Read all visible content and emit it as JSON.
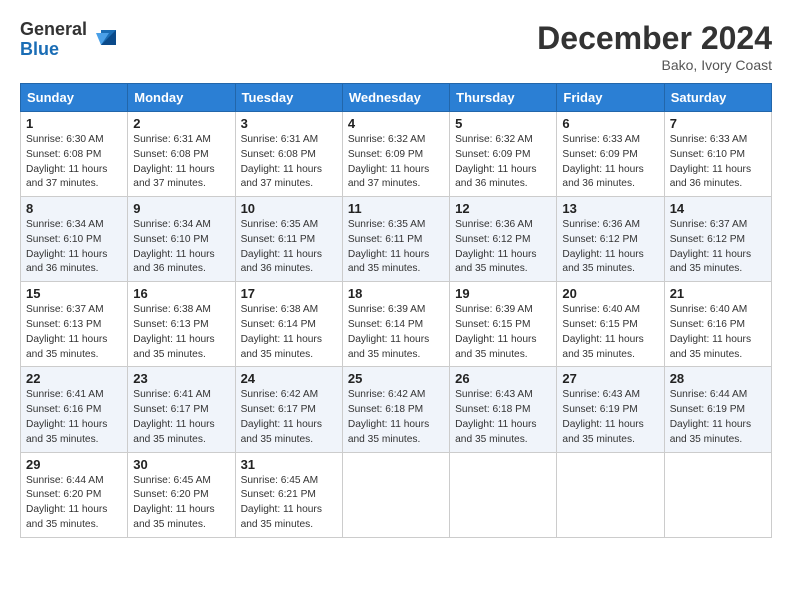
{
  "logo": {
    "general": "General",
    "blue": "Blue"
  },
  "title": "December 2024",
  "location": "Bako, Ivory Coast",
  "days_of_week": [
    "Sunday",
    "Monday",
    "Tuesday",
    "Wednesday",
    "Thursday",
    "Friday",
    "Saturday"
  ],
  "weeks": [
    [
      {
        "day": "1",
        "sunrise": "6:30 AM",
        "sunset": "6:08 PM",
        "daylight": "11 hours and 37 minutes."
      },
      {
        "day": "2",
        "sunrise": "6:31 AM",
        "sunset": "6:08 PM",
        "daylight": "11 hours and 37 minutes."
      },
      {
        "day": "3",
        "sunrise": "6:31 AM",
        "sunset": "6:08 PM",
        "daylight": "11 hours and 37 minutes."
      },
      {
        "day": "4",
        "sunrise": "6:32 AM",
        "sunset": "6:09 PM",
        "daylight": "11 hours and 37 minutes."
      },
      {
        "day": "5",
        "sunrise": "6:32 AM",
        "sunset": "6:09 PM",
        "daylight": "11 hours and 36 minutes."
      },
      {
        "day": "6",
        "sunrise": "6:33 AM",
        "sunset": "6:09 PM",
        "daylight": "11 hours and 36 minutes."
      },
      {
        "day": "7",
        "sunrise": "6:33 AM",
        "sunset": "6:10 PM",
        "daylight": "11 hours and 36 minutes."
      }
    ],
    [
      {
        "day": "8",
        "sunrise": "6:34 AM",
        "sunset": "6:10 PM",
        "daylight": "11 hours and 36 minutes."
      },
      {
        "day": "9",
        "sunrise": "6:34 AM",
        "sunset": "6:10 PM",
        "daylight": "11 hours and 36 minutes."
      },
      {
        "day": "10",
        "sunrise": "6:35 AM",
        "sunset": "6:11 PM",
        "daylight": "11 hours and 36 minutes."
      },
      {
        "day": "11",
        "sunrise": "6:35 AM",
        "sunset": "6:11 PM",
        "daylight": "11 hours and 35 minutes."
      },
      {
        "day": "12",
        "sunrise": "6:36 AM",
        "sunset": "6:12 PM",
        "daylight": "11 hours and 35 minutes."
      },
      {
        "day": "13",
        "sunrise": "6:36 AM",
        "sunset": "6:12 PM",
        "daylight": "11 hours and 35 minutes."
      },
      {
        "day": "14",
        "sunrise": "6:37 AM",
        "sunset": "6:12 PM",
        "daylight": "11 hours and 35 minutes."
      }
    ],
    [
      {
        "day": "15",
        "sunrise": "6:37 AM",
        "sunset": "6:13 PM",
        "daylight": "11 hours and 35 minutes."
      },
      {
        "day": "16",
        "sunrise": "6:38 AM",
        "sunset": "6:13 PM",
        "daylight": "11 hours and 35 minutes."
      },
      {
        "day": "17",
        "sunrise": "6:38 AM",
        "sunset": "6:14 PM",
        "daylight": "11 hours and 35 minutes."
      },
      {
        "day": "18",
        "sunrise": "6:39 AM",
        "sunset": "6:14 PM",
        "daylight": "11 hours and 35 minutes."
      },
      {
        "day": "19",
        "sunrise": "6:39 AM",
        "sunset": "6:15 PM",
        "daylight": "11 hours and 35 minutes."
      },
      {
        "day": "20",
        "sunrise": "6:40 AM",
        "sunset": "6:15 PM",
        "daylight": "11 hours and 35 minutes."
      },
      {
        "day": "21",
        "sunrise": "6:40 AM",
        "sunset": "6:16 PM",
        "daylight": "11 hours and 35 minutes."
      }
    ],
    [
      {
        "day": "22",
        "sunrise": "6:41 AM",
        "sunset": "6:16 PM",
        "daylight": "11 hours and 35 minutes."
      },
      {
        "day": "23",
        "sunrise": "6:41 AM",
        "sunset": "6:17 PM",
        "daylight": "11 hours and 35 minutes."
      },
      {
        "day": "24",
        "sunrise": "6:42 AM",
        "sunset": "6:17 PM",
        "daylight": "11 hours and 35 minutes."
      },
      {
        "day": "25",
        "sunrise": "6:42 AM",
        "sunset": "6:18 PM",
        "daylight": "11 hours and 35 minutes."
      },
      {
        "day": "26",
        "sunrise": "6:43 AM",
        "sunset": "6:18 PM",
        "daylight": "11 hours and 35 minutes."
      },
      {
        "day": "27",
        "sunrise": "6:43 AM",
        "sunset": "6:19 PM",
        "daylight": "11 hours and 35 minutes."
      },
      {
        "day": "28",
        "sunrise": "6:44 AM",
        "sunset": "6:19 PM",
        "daylight": "11 hours and 35 minutes."
      }
    ],
    [
      {
        "day": "29",
        "sunrise": "6:44 AM",
        "sunset": "6:20 PM",
        "daylight": "11 hours and 35 minutes."
      },
      {
        "day": "30",
        "sunrise": "6:45 AM",
        "sunset": "6:20 PM",
        "daylight": "11 hours and 35 minutes."
      },
      {
        "day": "31",
        "sunrise": "6:45 AM",
        "sunset": "6:21 PM",
        "daylight": "11 hours and 35 minutes."
      },
      null,
      null,
      null,
      null
    ]
  ]
}
